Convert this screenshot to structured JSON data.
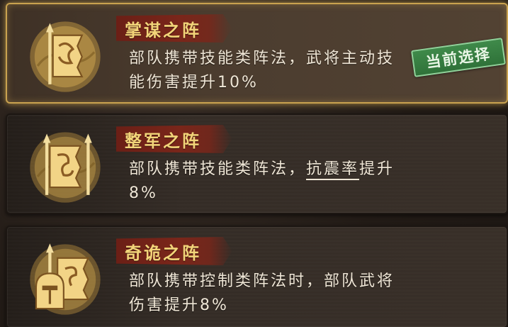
{
  "formations": [
    {
      "name": "掌谋之阵",
      "desc_parts": [
        "部队携带技能类阵法，武将主动技能伤害提升10%"
      ],
      "selected": true,
      "icon": "banner-spear-icon"
    },
    {
      "name": "整军之阵",
      "desc_parts": [
        "部队携带技能类阵法，",
        "抗震率",
        "提升8%"
      ],
      "selected": false,
      "icon": "banner-spear-icon"
    },
    {
      "name": "奇诡之阵",
      "desc_parts": [
        "部队携带控制类阵法时，部队武将伤害提升8%"
      ],
      "selected": false,
      "icon": "helmet-banner-icon"
    }
  ],
  "selected_stamp": "当前选择",
  "colors": {
    "selected_glow": "#dbb054",
    "title_gold": "#f2d479",
    "ribbon_red": "#7a261a",
    "stamp_green": "#3f8a4a"
  }
}
